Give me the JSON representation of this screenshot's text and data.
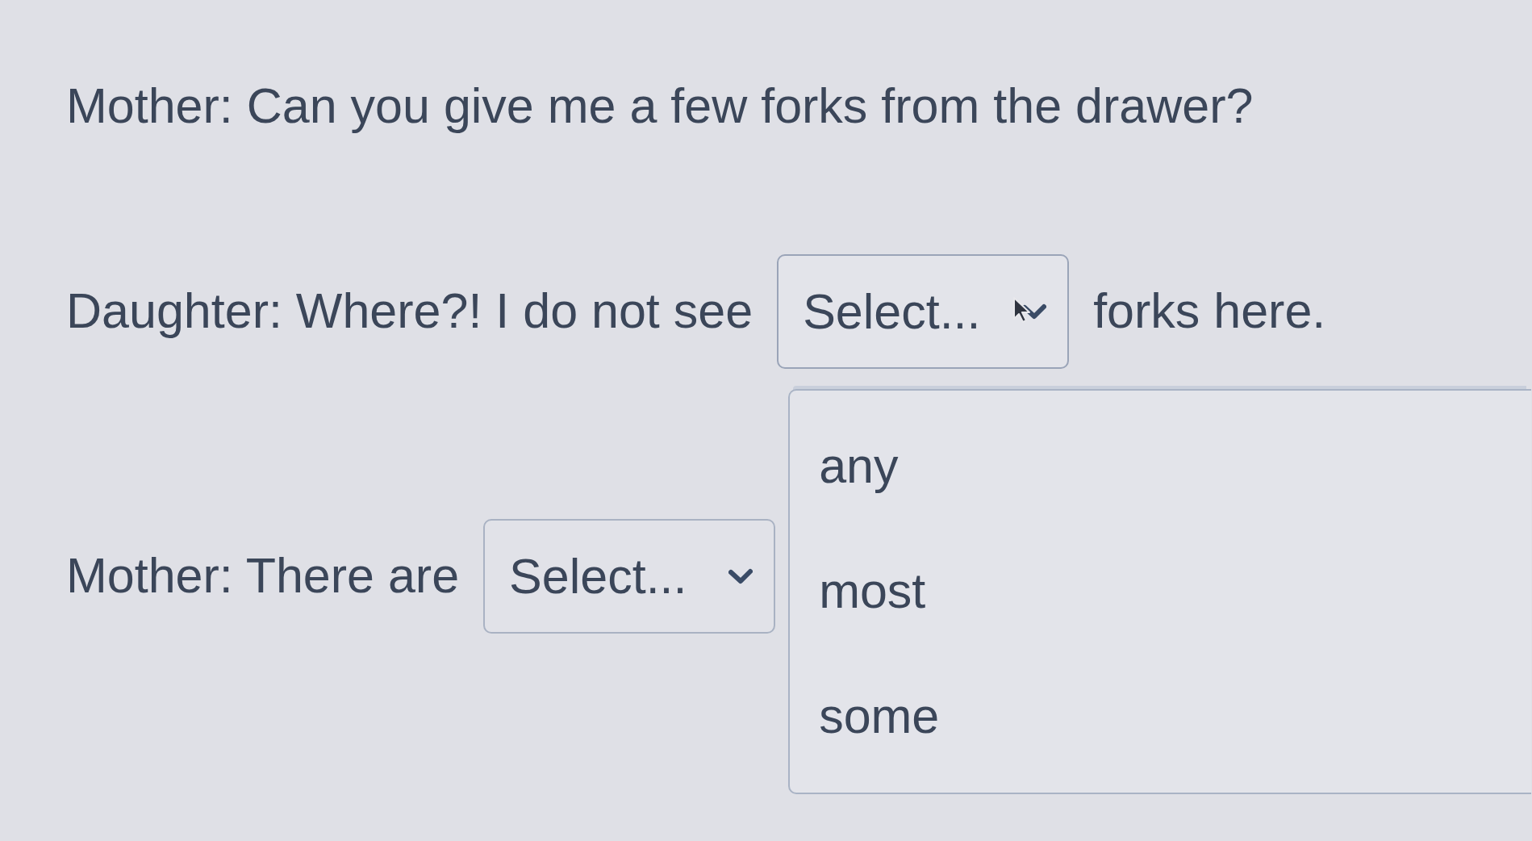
{
  "lines": [
    {
      "parts": [
        {
          "kind": "text",
          "text": "Mother: Can you give me a few forks from the drawer?"
        }
      ]
    },
    {
      "parts": [
        {
          "kind": "text",
          "text": "Daughter: Where?! I do not see"
        },
        {
          "kind": "select",
          "placeholder": "Select...",
          "expanded": true,
          "options": [
            {
              "label": "any",
              "selected": false
            },
            {
              "label": "most",
              "selected": false
            },
            {
              "label": "some",
              "selected": false
            }
          ]
        },
        {
          "kind": "text",
          "text": "forks here."
        }
      ]
    },
    {
      "parts": [
        {
          "kind": "text",
          "text": "Mother: There are"
        },
        {
          "kind": "select",
          "placeholder": "Select...",
          "expanded": false
        }
      ]
    }
  ]
}
